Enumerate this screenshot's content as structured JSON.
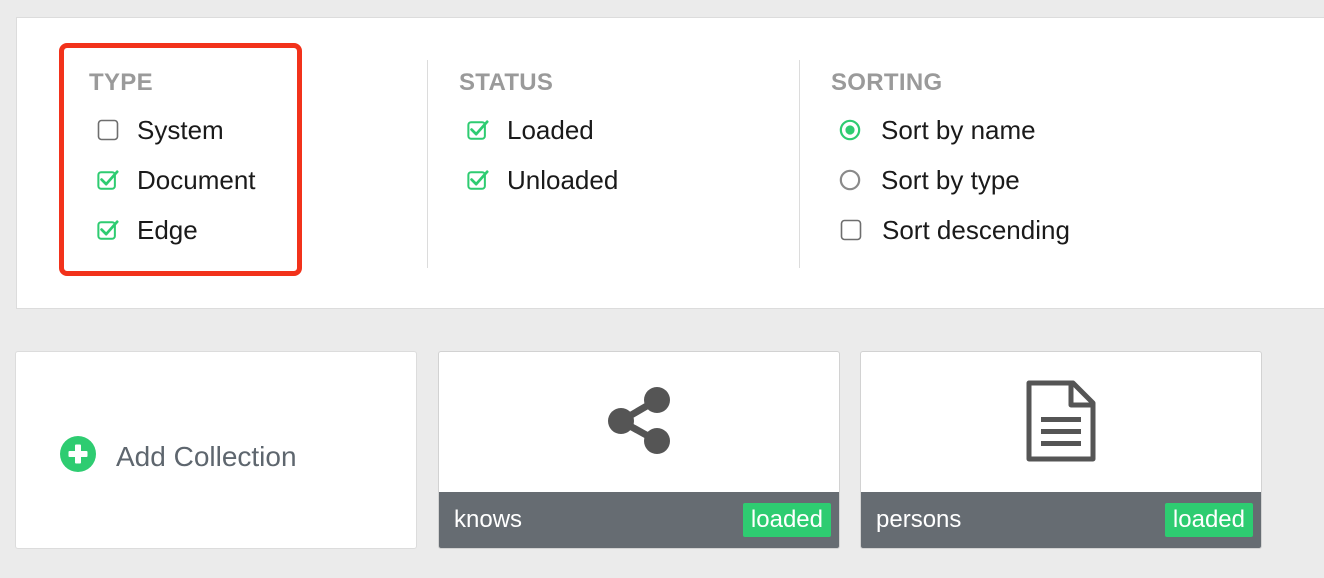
{
  "filters": {
    "type": {
      "title": "TYPE",
      "options": [
        {
          "label": "System",
          "checked": false
        },
        {
          "label": "Document",
          "checked": true
        },
        {
          "label": "Edge",
          "checked": true
        }
      ]
    },
    "status": {
      "title": "STATUS",
      "options": [
        {
          "label": "Loaded",
          "checked": true
        },
        {
          "label": "Unloaded",
          "checked": true
        }
      ]
    },
    "sorting": {
      "title": "SORTING",
      "options": [
        {
          "label": "Sort by name",
          "selected": true
        },
        {
          "label": "Sort by type",
          "selected": false
        },
        {
          "label": "Sort descending",
          "checked": false
        }
      ]
    }
  },
  "add_collection": {
    "label": "Add Collection"
  },
  "collections": [
    {
      "name": "knows",
      "status": "loaded",
      "icon": "share-icon"
    },
    {
      "name": "persons",
      "status": "loaded",
      "icon": "document-icon"
    }
  ],
  "colors": {
    "accent": "#2ecc71",
    "highlight": "#f2321b",
    "footer": "#666c72"
  }
}
